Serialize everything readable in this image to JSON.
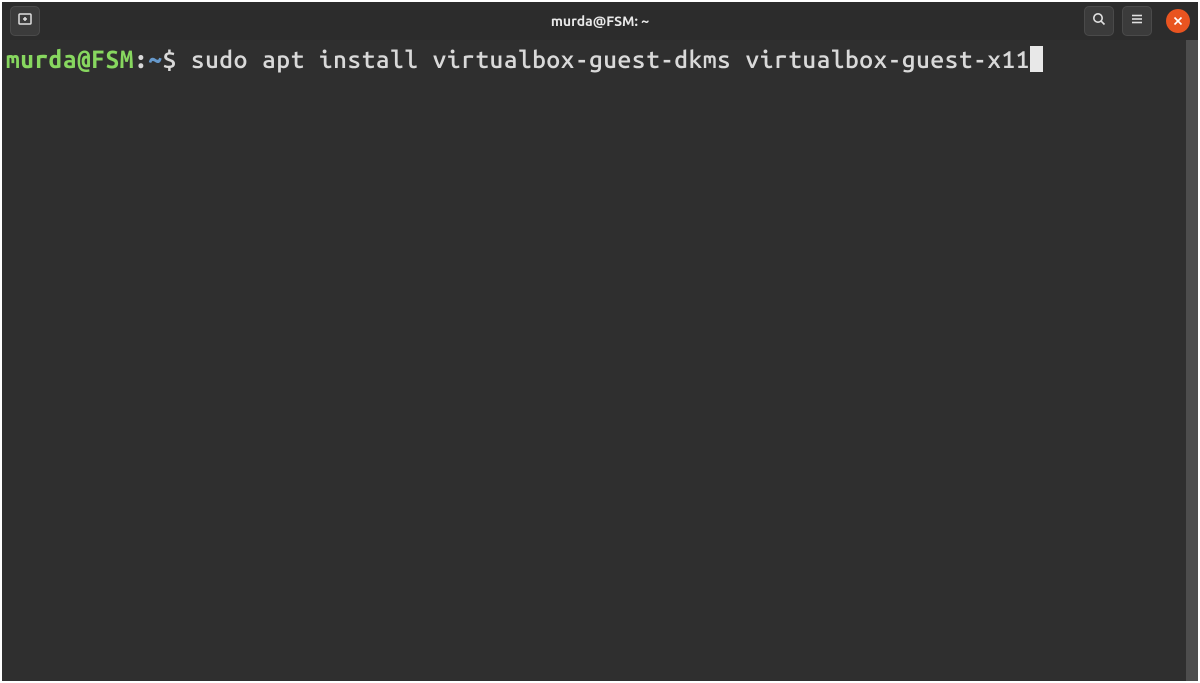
{
  "titlebar": {
    "title": "murda@FSM: ~"
  },
  "prompt": {
    "user_host": "murda@FSM",
    "separator": ":",
    "path": "~",
    "symbol": "$"
  },
  "command": " sudo apt install virtualbox-guest-dkms virtualbox-guest-x11",
  "icons": {
    "new_tab": "new-tab-icon",
    "search": "search-icon",
    "menu": "hamburger-icon",
    "close": "close-icon"
  }
}
